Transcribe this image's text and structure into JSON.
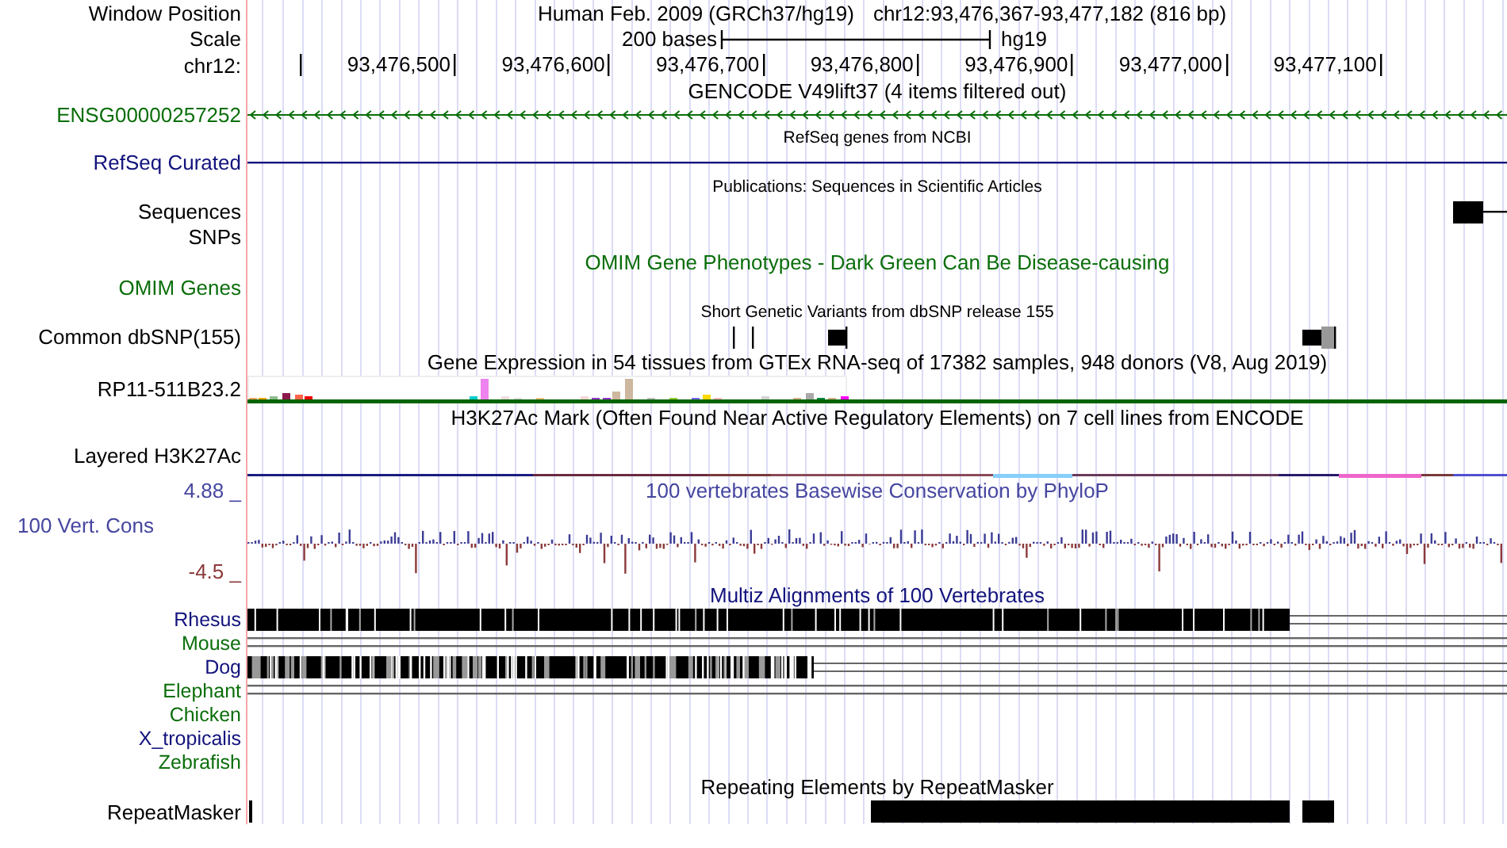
{
  "position": {
    "label": "Window Position",
    "assembly": "Human Feb. 2009 (GRCh37/hg19)",
    "range": "chr12:93,476,367-93,477,182 (816 bp)"
  },
  "scale": {
    "label": "Scale",
    "length": "200 bases",
    "assembly": "hg19"
  },
  "ruler": {
    "label": "chr12:",
    "ticks": [
      "93,476,500",
      "93,476,600",
      "93,476,700",
      "93,476,800",
      "93,476,900",
      "93,477,000",
      "93,477,100"
    ]
  },
  "tracks": [
    {
      "kind": "plain",
      "title": "GENCODE V49lift37 (4 items filtered out)",
      "color": "#000000",
      "rows": [
        {
          "label": "ENSG00000257252",
          "color": "#0a6e0a",
          "kind": "gene"
        }
      ]
    },
    {
      "kind": "plain",
      "title": "RefSeq genes from NCBI",
      "color": "#000000",
      "rows": [
        {
          "label": "RefSeq Curated",
          "color": "#12127d",
          "kind": "line"
        }
      ]
    },
    {
      "kind": "plain",
      "title": "Publications: Sequences in Scientific Articles",
      "color": "#000000",
      "rows": [
        {
          "label": "Sequences",
          "color": "#000000",
          "kind": "pubs"
        },
        {
          "label": "SNPs",
          "color": "#000000",
          "kind": "empty"
        }
      ]
    },
    {
      "kind": "plain",
      "title": "OMIM Gene Phenotypes - Dark Green Can Be Disease-causing",
      "color": "#0a6e0a",
      "rows": [
        {
          "label": "OMIM Genes",
          "color": "#0a6e0a",
          "kind": "empty"
        }
      ]
    },
    {
      "kind": "plain",
      "title": "Short Genetic Variants from dbSNP release 155",
      "color": "#000000",
      "rows": [
        {
          "label": "Common dbSNP(155)",
          "color": "#000000",
          "kind": "snp"
        }
      ]
    },
    {
      "kind": "plain",
      "title": "Gene Expression in 54 tissues from GTEx RNA-seq of 17382 samples, 948 donors (V8, Aug 2019)",
      "color": "#000000",
      "rows": [
        {
          "label": "RP11-511B23.2",
          "color": "#000000",
          "kind": "gtex"
        }
      ]
    },
    {
      "kind": "plain",
      "title": "H3K27Ac Mark (Often Found Near Active Regulatory Elements) on 7 cell lines from ENCODE",
      "color": "#000000",
      "rows": [
        {
          "label": "Layered H3K27Ac",
          "color": "#000000",
          "kind": "layered"
        }
      ]
    },
    {
      "kind": "phylop",
      "title": "100 vertebrates Basewise Conservation by PhyloP",
      "color": "#4646a0",
      "max": {
        "text": "4.88 _",
        "color": "#4646a0"
      },
      "min": {
        "text": "-4.5 _",
        "color": "#8b3a3a"
      },
      "rows": [
        {
          "label": "100 Vert. Cons",
          "color": "#4646a0",
          "kind": "wiggle"
        }
      ]
    },
    {
      "kind": "plain",
      "title": "Multiz Alignments of 100 Vertebrates",
      "color": "#12127d",
      "rows": [
        {
          "label": "Rhesus",
          "color": "#12127d",
          "kind": "full"
        },
        {
          "label": "Mouse",
          "color": "#0a6e0a",
          "kind": "lines"
        },
        {
          "label": "Dog",
          "color": "#12127d",
          "kind": "partial"
        },
        {
          "label": "Elephant",
          "color": "#0a6e0a",
          "kind": "lines"
        },
        {
          "label": "Chicken",
          "color": "#0a6e0a",
          "kind": "none"
        },
        {
          "label": "X_tropicalis",
          "color": "#12127d",
          "kind": "none"
        },
        {
          "label": "Zebrafish",
          "color": "#0a6e0a",
          "kind": "none"
        }
      ]
    },
    {
      "kind": "plain",
      "title": "Repeating Elements by RepeatMasker",
      "color": "#000000",
      "rows": [
        {
          "label": "RepeatMasker",
          "color": "#000000",
          "kind": "repeat"
        }
      ]
    }
  ]
}
